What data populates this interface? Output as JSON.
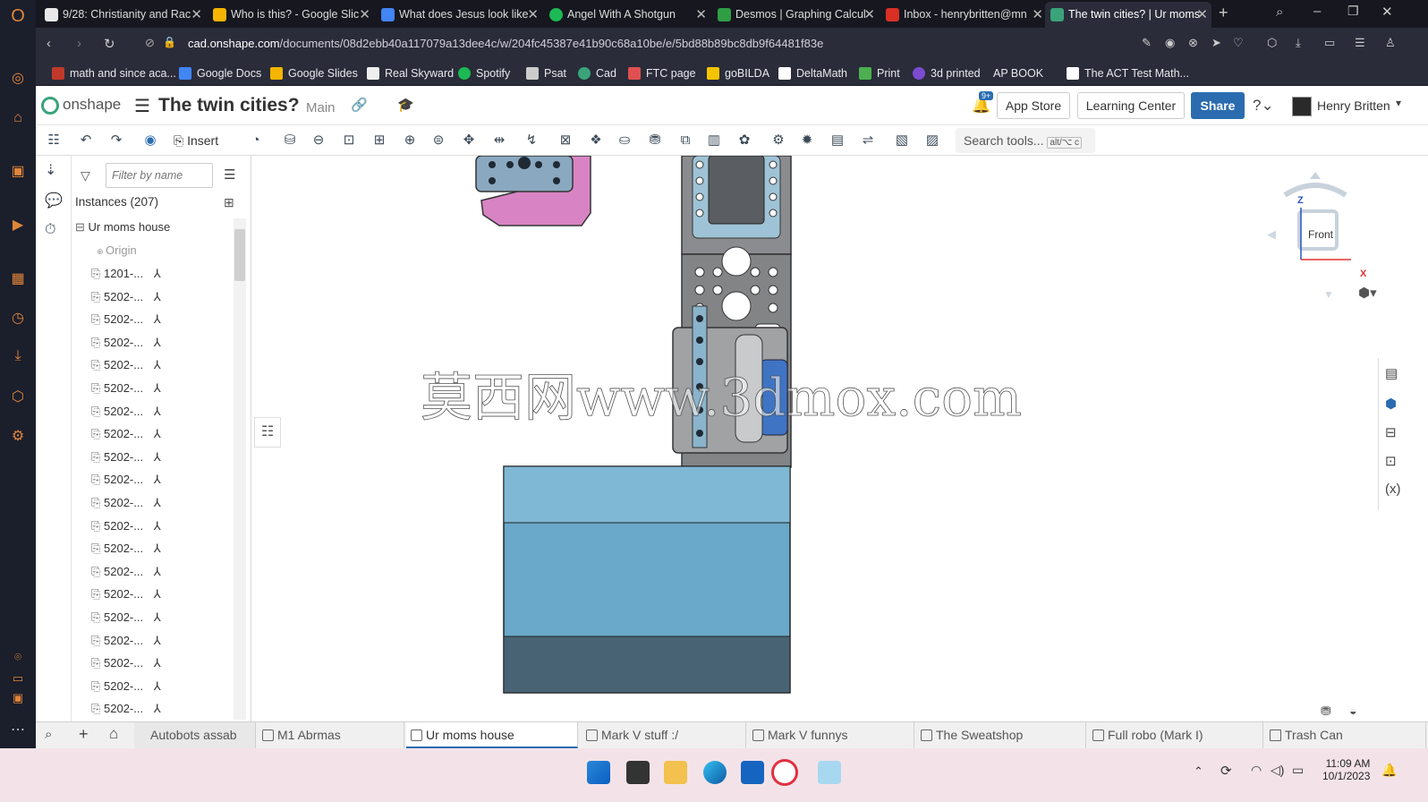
{
  "browser": {
    "tabs": [
      {
        "label": "9/28: Christianity and Rac",
        "color": "#e8e8e8"
      },
      {
        "label": "Who is this? - Google Slic",
        "color": "#f4b400"
      },
      {
        "label": "What does Jesus look like",
        "color": "#4285f4"
      },
      {
        "label": "Angel With A Shotgun",
        "color": "#1db954"
      },
      {
        "label": "Desmos | Graphing Calcul",
        "color": "#2f9e44"
      },
      {
        "label": "Inbox - henrybritten@mn",
        "color": "#d93025"
      },
      {
        "label": "The twin cities? | Ur moms",
        "color": "#3aa37a"
      }
    ],
    "new_tab": "+",
    "url_host": "cad.onshape.com",
    "url_path": "/documents/08d2ebb40a117079a13dee4c/w/204fc45387e41b90c68a10be/e/5bd88b89bc8db9f64481f83e"
  },
  "bookmarks": [
    {
      "label": "math and since aca...",
      "color": "#c0392b"
    },
    {
      "label": "Google Docs",
      "color": "#4285f4"
    },
    {
      "label": "Google Slides",
      "color": "#f4b400"
    },
    {
      "label": "Real Skyward",
      "color": "#eeeeee"
    },
    {
      "label": "Spotify",
      "color": "#1db954"
    },
    {
      "label": "Psat",
      "color": "#cccccc"
    },
    {
      "label": "Cad",
      "color": "#3aa37a"
    },
    {
      "label": "FTC page",
      "color": "#e05050"
    },
    {
      "label": "goBILDA",
      "color": "#f5c400"
    },
    {
      "label": "DeltaMath",
      "color": "#ffffff"
    },
    {
      "label": "Print",
      "color": "#4caf50"
    },
    {
      "label": "3d printed",
      "color": "#7b4bd0"
    },
    {
      "label": "AP BOOK",
      "color": ""
    },
    {
      "label": "The ACT Test Math...",
      "color": "#ffffff"
    }
  ],
  "onshape": {
    "logo": "onshape",
    "doc_title": "The twin cities?",
    "branch": "Main",
    "notification_count": "9+",
    "app_store": "App Store",
    "learning_center": "Learning Center",
    "share": "Share",
    "user_name": "Henry Britten",
    "insert_label": "Insert",
    "search_tools": "Search tools...",
    "search_shortcut": "alt/⌥ c"
  },
  "featurepanel": {
    "filter_placeholder": "Filter by name",
    "instances_header": "Instances (207)",
    "root_name": "Ur moms house",
    "origin": "Origin",
    "items": [
      "1201-...",
      "5202-...",
      "5202-...",
      "5202-...",
      "5202-...",
      "5202-...",
      "5202-...",
      "5202-...",
      "5202-...",
      "5202-...",
      "5202-...",
      "5202-...",
      "5202-...",
      "5202-...",
      "5202-...",
      "5202-...",
      "5202-...",
      "5202-...",
      "5202-...",
      "5202-..."
    ]
  },
  "viewcube": {
    "face": "Front",
    "axis_z": "Z",
    "axis_x": "X"
  },
  "watermark": "莫西网www.3dmox.com",
  "bottom_tabs": [
    {
      "label": "Autobots assab",
      "active": false
    },
    {
      "label": "M1 Abrmas",
      "active": false
    },
    {
      "label": "Ur moms house",
      "active": true
    },
    {
      "label": "Mark V stuff :/",
      "active": false
    },
    {
      "label": "Mark V funnys",
      "active": false
    },
    {
      "label": "The Sweatshop",
      "active": false
    },
    {
      "label": "Full robo (Mark I)",
      "active": false
    },
    {
      "label": "Trash Can",
      "active": false
    }
  ],
  "taskbar": {
    "time": "11:09 AM",
    "date": "10/1/2023"
  },
  "colors": {
    "accent": "#2b6cb0",
    "share": "#2b6cb0",
    "part_blue": "#6aa9c9",
    "part_dark": "#486474",
    "plate": "#828486",
    "pink": "#d884c4"
  }
}
